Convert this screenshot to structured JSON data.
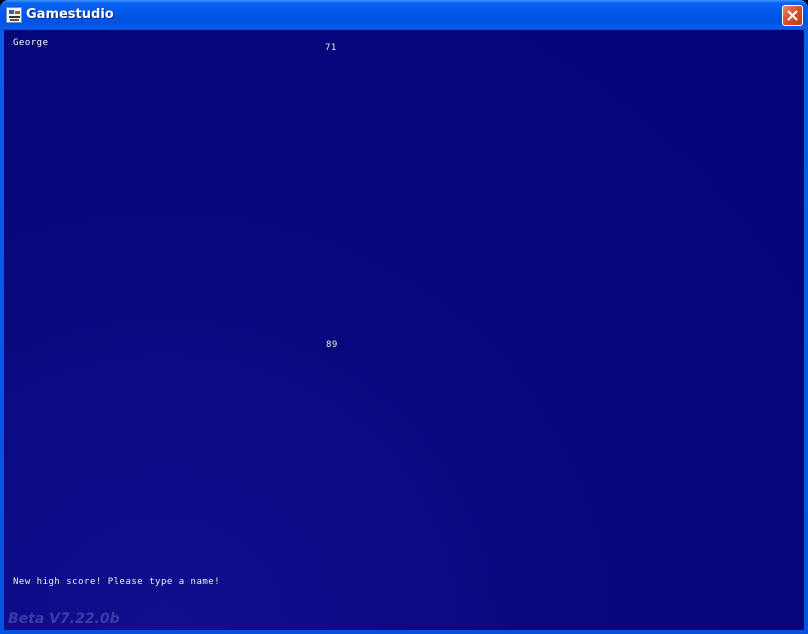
{
  "window": {
    "title": "Gamestudio",
    "icon": "gamestudio-app-icon",
    "close_icon": "close-icon"
  },
  "game": {
    "player_name": "George",
    "score_top": "71",
    "score_mid": "89",
    "status_message": "New high score! Please type a name!",
    "version": "Beta V7.22.0b"
  },
  "colors": {
    "client_background": "#06067e",
    "titlebar": "#0052e0",
    "text": "#ffffff",
    "version_text": "#3b3ba8"
  }
}
